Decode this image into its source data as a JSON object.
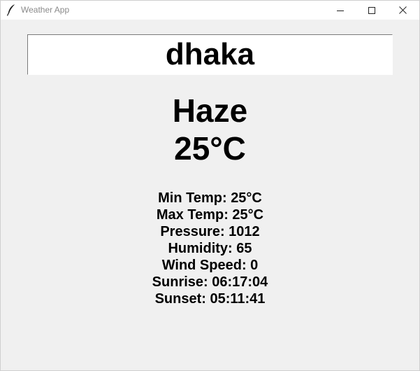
{
  "window": {
    "title": "Weather App",
    "controls": [
      "minimize",
      "maximize",
      "close"
    ]
  },
  "search": {
    "city_value": "dhaka"
  },
  "weather": {
    "condition": "Haze",
    "temperature": "25°C"
  },
  "details": {
    "min_temp": "Min Temp: 25°C",
    "max_temp": "Max Temp: 25°C",
    "pressure": "Pressure: 1012",
    "humidity": "Humidity: 65",
    "wind_speed": "Wind Speed: 0",
    "sunrise": "Sunrise: 06:17:04",
    "sunset": "Sunset: 05:11:41"
  },
  "colors": {
    "background": "#f0f0f0",
    "titlebar": "#ffffff",
    "text": "#000000"
  }
}
